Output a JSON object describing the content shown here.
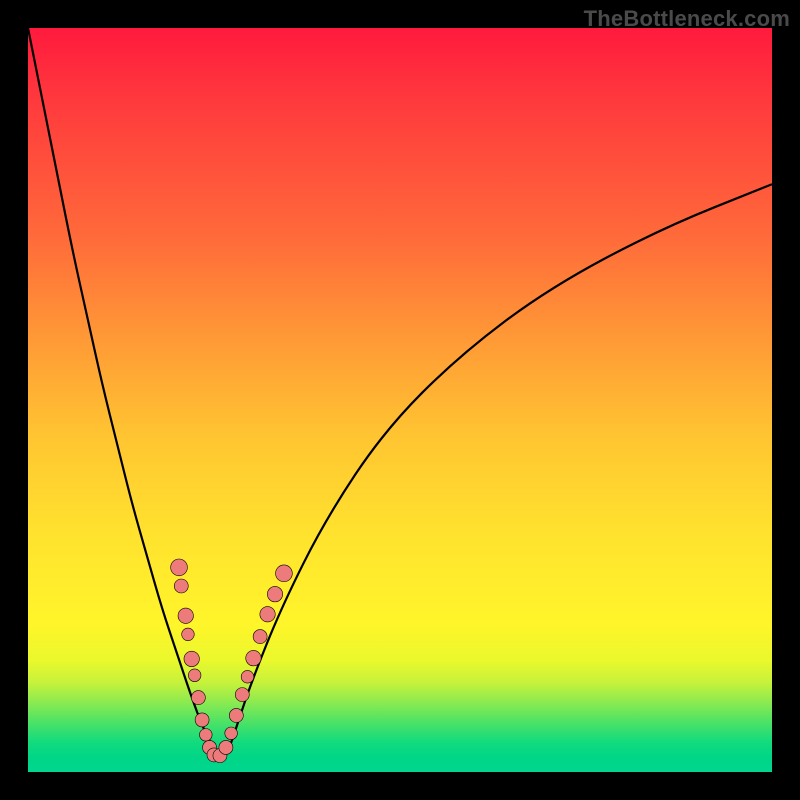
{
  "attribution": "TheBottleneck.com",
  "colors": {
    "page_bg": "#000000",
    "gradient_top": "#ff1a3d",
    "gradient_mid": "#ffe22e",
    "gradient_bottom": "#00d68f",
    "curve": "#000000",
    "points_fill": "#ee7b7b",
    "points_stroke": "#000000"
  },
  "chart_data": {
    "type": "line",
    "title": "",
    "xlabel": "",
    "ylabel": "",
    "xlim": [
      0,
      100
    ],
    "ylim": [
      0,
      100
    ],
    "grid": false,
    "legend": false,
    "series": [
      {
        "name": "bottleneck-curve",
        "color": "#000000",
        "x": [
          0,
          2,
          4,
          6,
          8,
          10,
          12,
          14,
          16,
          18,
          20,
          22,
          23.5,
          25,
          26,
          27,
          28,
          30,
          34,
          40,
          48,
          58,
          70,
          85,
          100
        ],
        "y": [
          100,
          90,
          80,
          70,
          61,
          52,
          44,
          36,
          29,
          22,
          16,
          10,
          6,
          3,
          2,
          3,
          6,
          12,
          22,
          34,
          46,
          56,
          65,
          73,
          79
        ]
      }
    ],
    "points": [
      {
        "x": 20.3,
        "y": 27.5,
        "r": 1.2
      },
      {
        "x": 20.6,
        "y": 25.0,
        "r": 1.0
      },
      {
        "x": 21.2,
        "y": 21.0,
        "r": 1.1
      },
      {
        "x": 21.5,
        "y": 18.5,
        "r": 0.9
      },
      {
        "x": 22.0,
        "y": 15.2,
        "r": 1.1
      },
      {
        "x": 22.4,
        "y": 13.0,
        "r": 0.9
      },
      {
        "x": 22.9,
        "y": 10.0,
        "r": 1.0
      },
      {
        "x": 23.4,
        "y": 7.0,
        "r": 1.0
      },
      {
        "x": 23.9,
        "y": 5.0,
        "r": 0.9
      },
      {
        "x": 24.4,
        "y": 3.3,
        "r": 1.0
      },
      {
        "x": 25.0,
        "y": 2.3,
        "r": 1.0
      },
      {
        "x": 25.8,
        "y": 2.2,
        "r": 1.0
      },
      {
        "x": 26.6,
        "y": 3.3,
        "r": 1.0
      },
      {
        "x": 27.3,
        "y": 5.2,
        "r": 0.9
      },
      {
        "x": 28.0,
        "y": 7.6,
        "r": 1.0
      },
      {
        "x": 28.8,
        "y": 10.4,
        "r": 1.0
      },
      {
        "x": 29.5,
        "y": 12.8,
        "r": 0.9
      },
      {
        "x": 30.3,
        "y": 15.3,
        "r": 1.1
      },
      {
        "x": 31.2,
        "y": 18.2,
        "r": 1.0
      },
      {
        "x": 32.2,
        "y": 21.2,
        "r": 1.1
      },
      {
        "x": 33.2,
        "y": 23.9,
        "r": 1.1
      },
      {
        "x": 34.4,
        "y": 26.7,
        "r": 1.2
      }
    ]
  }
}
